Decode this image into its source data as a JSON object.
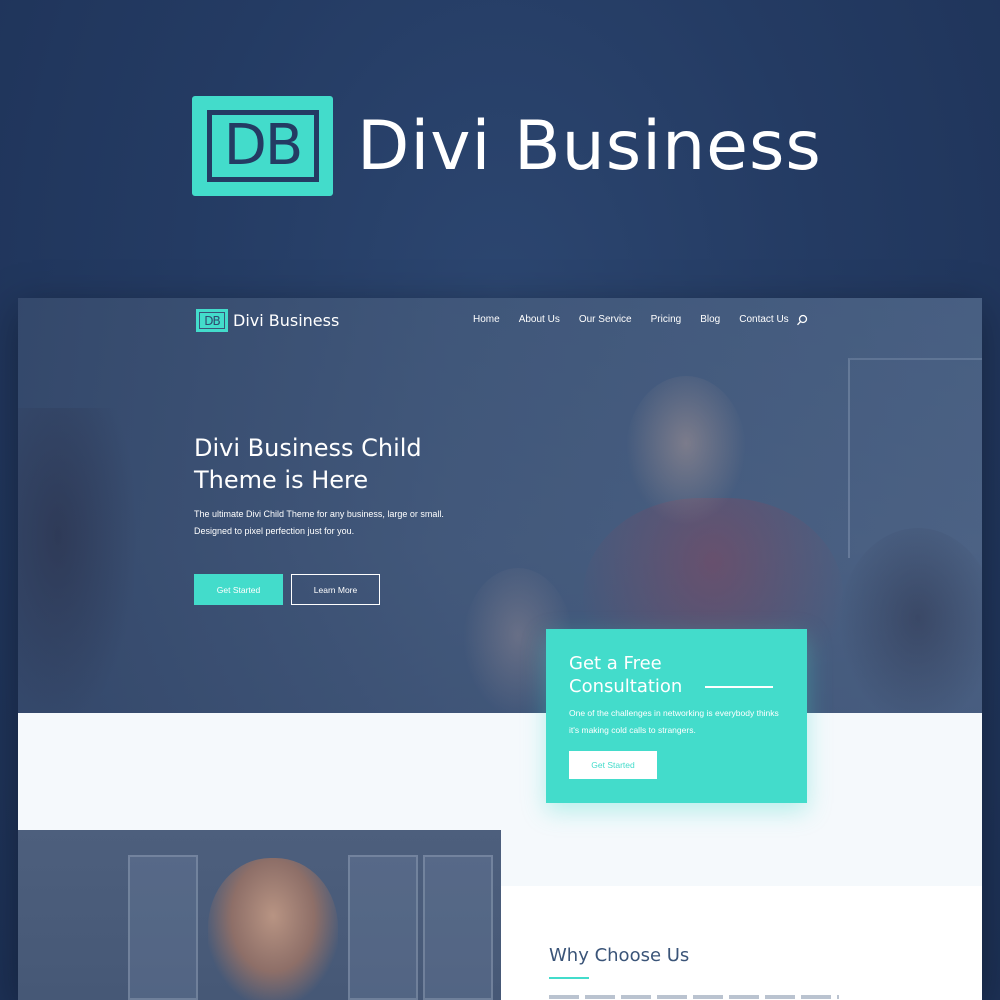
{
  "brand": {
    "logo_text": "DB",
    "name": "Divi Business"
  },
  "nav": {
    "logo_text": "DB",
    "site_name": "Divi Business",
    "items": [
      {
        "label": "Home"
      },
      {
        "label": "About Us"
      },
      {
        "label": "Our Service"
      },
      {
        "label": "Pricing"
      },
      {
        "label": "Blog"
      },
      {
        "label": "Contact Us"
      }
    ],
    "search_icon": "search-icon"
  },
  "hero": {
    "title": "Divi Business Child Theme is Here",
    "description": "The ultimate Divi Child Theme for any business, large or small. Designed to pixel perfection just for you.",
    "primary_button": "Get Started",
    "secondary_button": "Learn More"
  },
  "consultation": {
    "title": "Get a Free Consultation",
    "description": "One of the challenges in networking is everybody thinks it's making cold calls to strangers.",
    "button": "Get Started"
  },
  "why": {
    "title": "Why Choose Us"
  },
  "colors": {
    "accent": "#43dccb",
    "background": "#243b63",
    "heading": "#3a5478"
  }
}
